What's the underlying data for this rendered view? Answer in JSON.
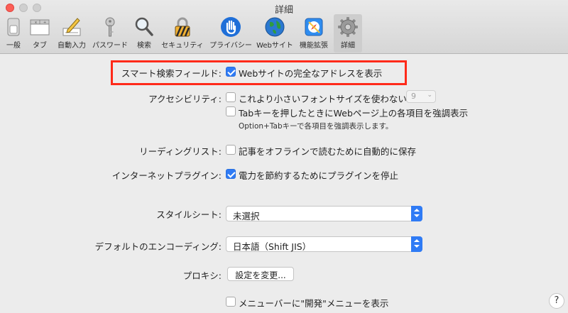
{
  "window": {
    "title": "詳細"
  },
  "toolbar": {
    "items": [
      {
        "label": "一般"
      },
      {
        "label": "タブ"
      },
      {
        "label": "自動入力"
      },
      {
        "label": "パスワード"
      },
      {
        "label": "検索"
      },
      {
        "label": "セキュリティ"
      },
      {
        "label": "プライバシー"
      },
      {
        "label": "Webサイト"
      },
      {
        "label": "機能拡張"
      },
      {
        "label": "詳細"
      }
    ],
    "active": "詳細"
  },
  "smart_search": {
    "label": "スマート検索フィールド:",
    "checkbox_label": "Webサイトの完全なアドレスを表示",
    "checked": true
  },
  "accessibility": {
    "label": "アクセシビリティ:",
    "font_size_label": "これより小さいフォントサイズを使わない:",
    "font_size_checked": false,
    "font_size_value": "9",
    "tab_label": "Tabキーを押したときにWebページ上の各項目を強調表示",
    "tab_checked": false,
    "tab_note": "Option+Tabキーで各項目を強調表示します。"
  },
  "reading_list": {
    "label": "リーディングリスト:",
    "checkbox_label": "記事をオフラインで読むために自動的に保存",
    "checked": false
  },
  "internet_plugins": {
    "label": "インターネットプラグイン:",
    "checkbox_label": "電力を節約するためにプラグインを停止",
    "checked": true
  },
  "style_sheet": {
    "label": "スタイルシート:",
    "value": "未選択"
  },
  "encoding": {
    "label": "デフォルトのエンコーディング:",
    "value": "日本語（Shift JIS）"
  },
  "proxy": {
    "label": "プロキシ:",
    "button_label": "設定を変更..."
  },
  "develop_menu": {
    "checkbox_label": "メニューバーに\"開発\"メニューを表示",
    "checked": false
  },
  "help": {
    "label": "?"
  },
  "colors": {
    "accent": "#2f7bf5",
    "highlight": "#ff2a1a"
  }
}
